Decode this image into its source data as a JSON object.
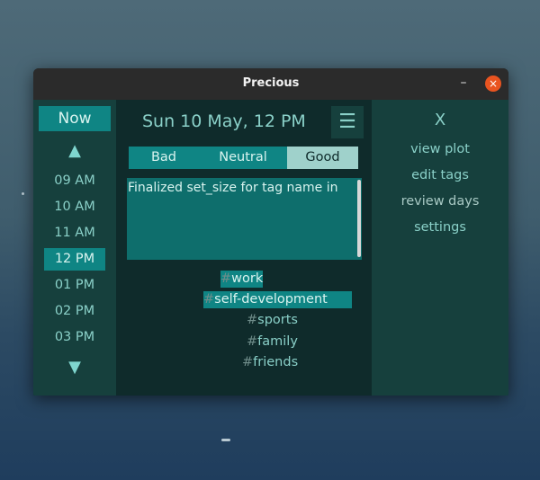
{
  "window": {
    "title": "Precious",
    "minimize_icon": "–",
    "close_icon": "×"
  },
  "left": {
    "now_label": "Now",
    "up_icon": "▲",
    "down_icon": "▼",
    "times": [
      "09 AM",
      "10 AM",
      "11 AM",
      "12 PM",
      "01 PM",
      "02 PM",
      "03 PM"
    ],
    "selected_time": "12 PM"
  },
  "center": {
    "date_title": "Sun 10 May, 12 PM",
    "menu_icon": "☰",
    "moods": [
      "Bad",
      "Neutral",
      "Good"
    ],
    "selected_mood": "Good",
    "note_text": "Finalized set_size for tag name in",
    "tags": [
      {
        "hash": "#",
        "name": "work",
        "selected": true
      },
      {
        "hash": "#",
        "name": "self-development",
        "selected": true
      },
      {
        "hash": "#",
        "name": "sports",
        "selected": false
      },
      {
        "hash": "#",
        "name": "family",
        "selected": false
      },
      {
        "hash": "#",
        "name": "friends",
        "selected": false
      }
    ]
  },
  "right": {
    "close_label": "X",
    "items": [
      "view plot",
      "edit tags",
      "review days",
      "settings"
    ]
  },
  "colors": {
    "accent": "#0f8584",
    "panel": "#16403d",
    "background": "#0f2b2b",
    "text": "#8ad0c8",
    "close_button": "#e95420"
  }
}
